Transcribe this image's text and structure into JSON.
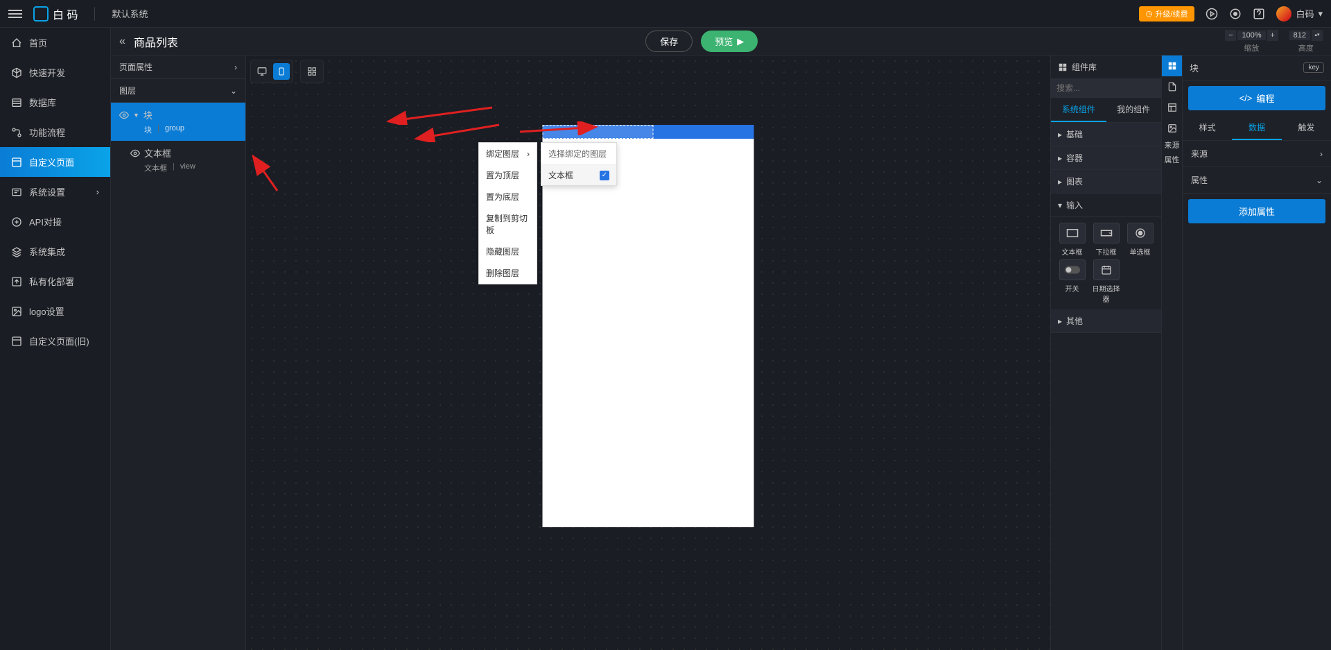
{
  "header": {
    "brand": "白 码",
    "system": "默认系统",
    "upgrade": "升级/续费",
    "user": "白码"
  },
  "sidebar": {
    "items": [
      {
        "label": "首页"
      },
      {
        "label": "快速开发"
      },
      {
        "label": "数据库"
      },
      {
        "label": "功能流程"
      },
      {
        "label": "自定义页面"
      },
      {
        "label": "系统设置"
      },
      {
        "label": "API对接"
      },
      {
        "label": "系统集成"
      },
      {
        "label": "私有化部署"
      },
      {
        "label": "logo设置"
      },
      {
        "label": "自定义页面(旧)"
      }
    ]
  },
  "toolbar": {
    "title": "商品列表",
    "save": "保存",
    "preview": "预览",
    "zoom_value": "100%",
    "zoom_label": "缩放",
    "width_value": "812",
    "width_label": "高度"
  },
  "layers": {
    "page_attr": "页面属性",
    "layer_label": "图层",
    "block": {
      "name": "块",
      "type": "块",
      "kind": "group"
    },
    "text": {
      "name": "文本框",
      "type": "文本框",
      "kind": "view"
    }
  },
  "ctx": {
    "items": [
      "绑定图层",
      "置为顶层",
      "置为底层",
      "复制到剪切板",
      "隐藏图层",
      "删除图层"
    ],
    "sub_header": "选择绑定的图层",
    "sub_item": "文本框"
  },
  "comp": {
    "title": "组件库",
    "search_ph": "搜索...",
    "tab_sys": "系统组件",
    "tab_my": "我的组件",
    "cats": [
      "基础",
      "容器",
      "图表",
      "输入",
      "其他"
    ],
    "input_items": [
      "文本框",
      "下拉框",
      "单选框",
      "开关",
      "日期选择器"
    ]
  },
  "tools": {
    "source": "来源",
    "attr": "属性"
  },
  "props": {
    "title": "块",
    "key": "key",
    "code": "编程",
    "tab_style": "样式",
    "tab_data": "数据",
    "tab_trigger": "触发",
    "source": "来源",
    "attribute": "属性",
    "add": "添加属性"
  }
}
